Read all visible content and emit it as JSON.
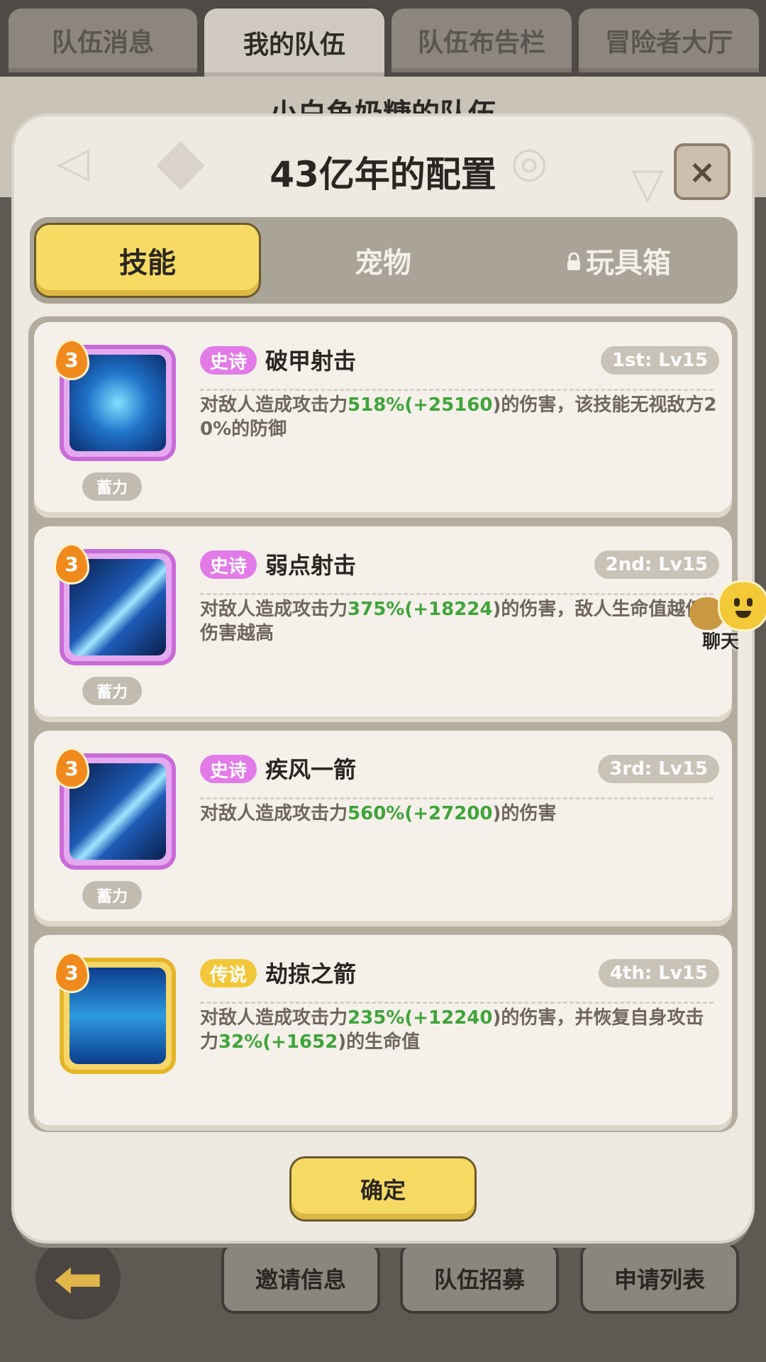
{
  "top_tabs": [
    "队伍消息",
    "我的队伍",
    "队伍布告栏",
    "冒险者大厅"
  ],
  "behind_title": "小白鱼奶糖的队伍",
  "modal": {
    "title": "43亿年的配置",
    "close_label": "×",
    "tabs": {
      "skill": "技能",
      "pet": "宠物",
      "toybox": "玩具箱"
    },
    "confirm_label": "确定"
  },
  "skills": [
    {
      "rarity": "史诗",
      "name": "破甲射击",
      "slot": "1st: Lv15",
      "level": "3",
      "tag": "蓄力",
      "desc": [
        "对敌人造成攻击力",
        "518",
        "%(+",
        "25160",
        ")的伤害，该技能无视敌方20%的防御"
      ]
    },
    {
      "rarity": "史诗",
      "name": "弱点射击",
      "slot": "2nd: Lv15",
      "level": "3",
      "tag": "蓄力",
      "desc": [
        "对敌人造成攻击力",
        "375",
        "%(+",
        "18224",
        ")的伤害，敌人生命值越低伤害越高"
      ]
    },
    {
      "rarity": "史诗",
      "name": "疾风一箭",
      "slot": "3rd: Lv15",
      "level": "3",
      "tag": "蓄力",
      "desc": [
        "对敌人造成攻击力",
        "560",
        "%(+",
        "27200",
        ")的伤害"
      ]
    },
    {
      "rarity": "传说",
      "name": "劫掠之箭",
      "slot": "4th: Lv15",
      "level": "3",
      "tag": "",
      "desc": [
        "对敌人造成攻击力",
        "235",
        "%(+",
        "12240",
        ")的伤害，并恢复自身攻击力",
        "32",
        "%(+",
        "1652",
        ")的生命值"
      ]
    }
  ],
  "bottom_buttons": [
    "邀请信息",
    "队伍招募",
    "申请列表"
  ],
  "chat_label": "聊天"
}
